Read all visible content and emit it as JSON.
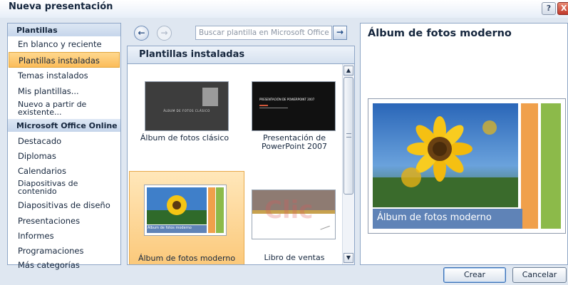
{
  "window": {
    "title": "Nueva presentación",
    "help_label": "?",
    "close_label": "X"
  },
  "left_panel": {
    "sections": [
      {
        "header": "Plantillas",
        "items": [
          {
            "label": "En blanco y reciente",
            "selected": false
          },
          {
            "label": "Plantillas instaladas",
            "selected": true
          },
          {
            "label": "Temas instalados",
            "selected": false
          },
          {
            "label": "Mis plantillas...",
            "selected": false
          },
          {
            "label": "Nuevo a partir de existente...",
            "selected": false
          }
        ]
      },
      {
        "header": "Microsoft Office Online",
        "items": [
          {
            "label": "Destacado"
          },
          {
            "label": "Diplomas"
          },
          {
            "label": "Calendarios"
          },
          {
            "label": "Diapositivas de contenido"
          },
          {
            "label": "Diapositivas de diseño"
          },
          {
            "label": "Presentaciones"
          },
          {
            "label": "Informes"
          },
          {
            "label": "Programaciones"
          },
          {
            "label": "Más categorías"
          }
        ]
      }
    ]
  },
  "center_panel": {
    "search_placeholder": "Buscar plantilla en Microsoft Office Online",
    "gallery_title": "Plantillas instaladas",
    "templates": [
      {
        "label": "Álbum de fotos clásico",
        "thumb_text": "ÁLBUM DE FOTOS CLÁSICO",
        "selected": false
      },
      {
        "label": "Presentación de PowerPoint 2007",
        "thumb_text": "PRESENTACIÓN DE POWERPOINT 2007",
        "selected": false
      },
      {
        "label": "Álbum de fotos moderno",
        "thumb_text": "Álbum de fotos moderno",
        "selected": true
      },
      {
        "label": "Libro de ventas",
        "thumb_text": "",
        "selected": false
      }
    ],
    "watermark_text": "Clic"
  },
  "preview": {
    "title": "Álbum de fotos moderno",
    "caption": "Álbum de fotos moderno"
  },
  "buttons": {
    "create": "Crear",
    "cancel": "Cancelar"
  },
  "colors": {
    "selection": "#fbbc59",
    "panel_border": "#8ea6c6",
    "caption_blue": "#5f83b7",
    "thumb_orange": "#f0a04b",
    "thumb_green": "#8cba4a"
  }
}
